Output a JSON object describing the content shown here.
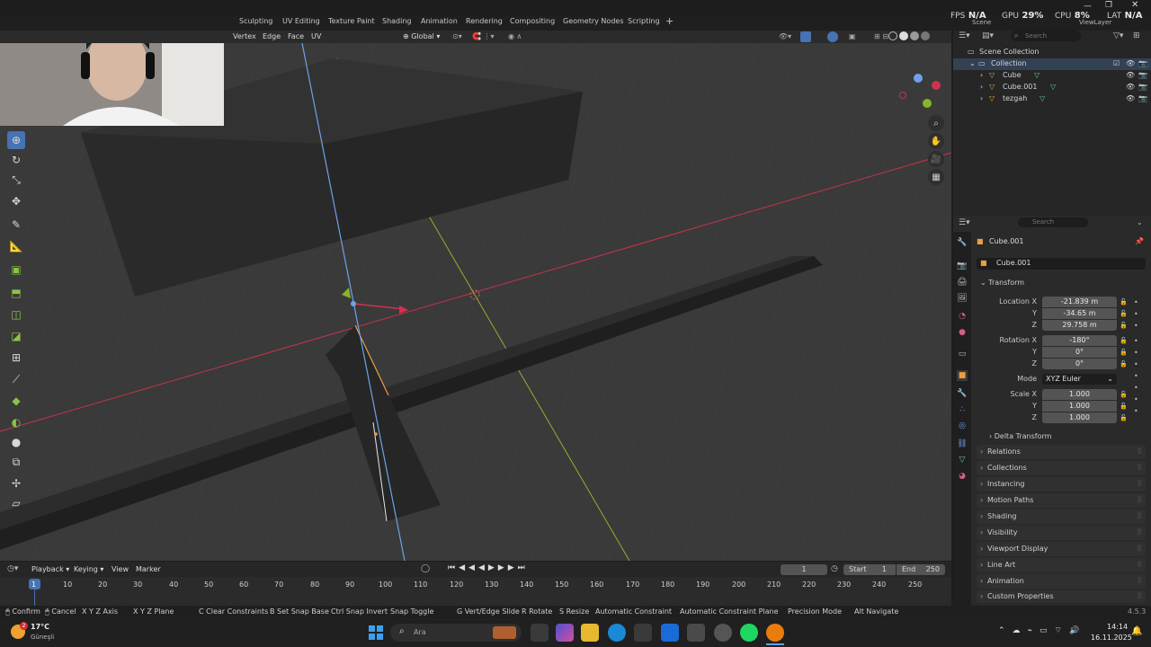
{
  "workspace_tabs": [
    "Sculpting",
    "UV Editing",
    "Texture Paint",
    "Shading",
    "Animation",
    "Rendering",
    "Compositing",
    "Geometry Nodes",
    "Scripting",
    "+"
  ],
  "overlay_stats": {
    "fps_label": "FPS",
    "fps": "N/A",
    "gpu_label": "GPU",
    "gpu": "29%",
    "cpu_label": "CPU",
    "cpu": "8%",
    "lat_label": "LAT",
    "lat": "N/A"
  },
  "top_right": {
    "scene": "Scene",
    "view_layer": "ViewLayer"
  },
  "viewport_header": {
    "menus": [
      "Vertex",
      "Edge",
      "Face",
      "UV"
    ],
    "orientation": "Global"
  },
  "outliner": {
    "search_placeholder": "Search",
    "root": "Scene Collection",
    "collection": "Collection",
    "items": [
      "Cube",
      "Cube.001",
      "tezgah"
    ]
  },
  "properties": {
    "search_placeholder": "Search",
    "object_name": "Cube.001",
    "object_field": "Cube.001",
    "transform_label": "Transform",
    "location_label": "Location X",
    "location": {
      "x": "-21.839 m",
      "y": "-34.65 m",
      "z": "29.758 m"
    },
    "rotation_label": "Rotation X",
    "rotation": {
      "x": "-180°",
      "y": "0°",
      "z": "0°"
    },
    "mode_label": "Mode",
    "mode_value": "XYZ Euler",
    "scale_label": "Scale X",
    "scale": {
      "x": "1.000",
      "y": "1.000",
      "z": "1.000"
    },
    "axis_y": "Y",
    "axis_z": "Z",
    "delta_transform": "Delta Transform",
    "panels": [
      "Relations",
      "Collections",
      "Instancing",
      "Motion Paths",
      "Shading",
      "Visibility",
      "Viewport Display",
      "Line Art",
      "Animation",
      "Custom Properties"
    ]
  },
  "timeline": {
    "menus": [
      "Playback",
      "Keying",
      "View",
      "Marker"
    ],
    "current_frame": "1",
    "start_label": "Start",
    "start": "1",
    "end_label": "End",
    "end": "250",
    "ruler": [
      "1",
      "10",
      "20",
      "30",
      "40",
      "50",
      "60",
      "70",
      "80",
      "90",
      "100",
      "110",
      "120",
      "130",
      "140",
      "150",
      "160",
      "170",
      "180",
      "190",
      "200",
      "210",
      "220",
      "230",
      "240",
      "250"
    ]
  },
  "statusbar": {
    "items": [
      "Confirm",
      "Cancel",
      "X Y Z Axis",
      "X Y Z Plane",
      "Clear Constraints",
      "Set Snap Base",
      "Snap Invert",
      "Snap Toggle",
      "Vert/Edge Slide",
      "Rotate",
      "Resize",
      "Automatic Constraint",
      "Automatic Constraint Plane",
      "Precision Mode",
      "Navigate"
    ],
    "keys": [
      "",
      "",
      "",
      "",
      "C",
      "B",
      "Ctrl",
      "",
      "G",
      "R",
      "S",
      "",
      "",
      "",
      "Alt"
    ],
    "version": "4.5.3"
  },
  "taskbar": {
    "weather_temp": "17°C",
    "weather_loc": "Güneşli",
    "search_placeholder": "Ara",
    "time": "14:14",
    "date": "16.11.2025",
    "badge": "2"
  },
  "colors": {
    "accent": "#4772b3",
    "x_axis": "#c8334a",
    "y_axis": "#8ab32c",
    "z_axis": "#4d8de0",
    "selected": "#e8a040"
  }
}
